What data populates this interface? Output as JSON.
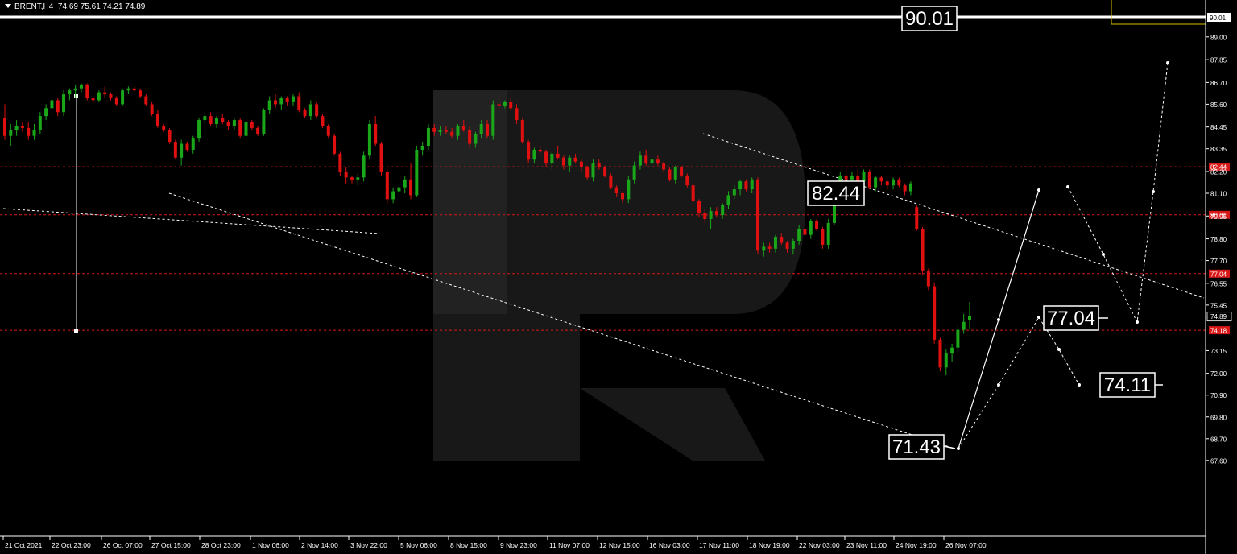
{
  "header": {
    "symbol": "BRENT,H4",
    "ohlc": "74.69 75.61 74.21 74.89"
  },
  "colors": {
    "background": "#000000",
    "bull": "#1aa81a",
    "bear": "#e01010",
    "level": "#d81818",
    "grid_text": "#ffffff",
    "watermark": "#2b2b2b",
    "sell_box": "#d4c000"
  },
  "chart_data": {
    "type": "candlestick",
    "y_axis_ticks": [
      "89.00",
      "87.85",
      "86.70",
      "85.60",
      "84.45",
      "83.35",
      "82.20",
      "81.10",
      "79.95",
      "78.80",
      "77.70",
      "76.55",
      "75.45",
      "74.89",
      "73.15",
      "72.00",
      "70.90",
      "69.80",
      "68.70",
      "67.60"
    ],
    "ylim": [
      67.6,
      90.2
    ],
    "x_axis_labels": [
      "21 Oct 2021",
      "22 Oct 23:00",
      "26 Oct 07:00",
      "27 Oct 15:00",
      "28 Oct 23:00",
      "1 Nov 06:00",
      "2 Nov 14:00",
      "3 Nov 22:00",
      "5 Nov 06:00",
      "8 Nov 15:00",
      "9 Nov 23:00",
      "11 Nov 07:00",
      "12 Nov 15:00",
      "16 Nov 03:00",
      "17 Nov 11:00",
      "18 Nov 19:00",
      "22 Nov 03:00",
      "23 Nov 11:00",
      "24 Nov 19:00",
      "26 Nov 07:00"
    ],
    "current_price": 74.89,
    "levels": [
      {
        "value": 90.01,
        "label": "90.01",
        "style": "solid-white"
      },
      {
        "value": 82.44,
        "label": "82.44",
        "style": "dashed-red"
      },
      {
        "value": 80.01,
        "label": "80.01",
        "style": "dashed-red"
      },
      {
        "value": 77.04,
        "label": "77.04",
        "style": "dashed-red"
      },
      {
        "value": 74.18,
        "label": "74.18",
        "style": "dashed-red"
      }
    ],
    "annotations": [
      {
        "text": "90.01",
        "value": 90.01
      },
      {
        "text": "82.44",
        "value": 82.44
      },
      {
        "text": "77.04",
        "value": 77.04
      },
      {
        "text": "74.11",
        "value": 74.11
      },
      {
        "text": "71.43",
        "value": 71.43
      }
    ],
    "candles": [
      [
        84.9,
        85.6,
        83.8,
        84.0
      ],
      [
        84.0,
        84.6,
        83.5,
        84.3
      ],
      [
        84.3,
        84.8,
        84.0,
        84.5
      ],
      [
        84.5,
        84.7,
        84.2,
        84.4
      ],
      [
        84.4,
        84.7,
        83.8,
        84.0
      ],
      [
        84.0,
        84.6,
        83.8,
        84.3
      ],
      [
        84.3,
        85.2,
        84.1,
        85.0
      ],
      [
        85.0,
        85.6,
        84.8,
        85.4
      ],
      [
        85.4,
        86.0,
        85.0,
        85.8
      ],
      [
        85.8,
        85.9,
        85.0,
        85.2
      ],
      [
        85.2,
        86.3,
        85.0,
        86.1
      ],
      [
        86.1,
        86.4,
        85.8,
        86.3
      ],
      [
        86.3,
        86.6,
        85.9,
        86.4
      ],
      [
        86.4,
        86.65,
        86.2,
        86.6
      ],
      [
        86.6,
        86.65,
        85.8,
        85.9
      ],
      [
        85.9,
        86.0,
        85.6,
        85.8
      ],
      [
        85.8,
        86.3,
        85.7,
        86.2
      ],
      [
        86.2,
        86.5,
        85.9,
        86.1
      ],
      [
        86.1,
        86.2,
        85.8,
        85.9
      ],
      [
        85.9,
        86.0,
        85.5,
        85.6
      ],
      [
        85.6,
        86.4,
        85.5,
        86.3
      ],
      [
        86.3,
        86.5,
        86.1,
        86.4
      ],
      [
        86.4,
        86.5,
        86.2,
        86.3
      ],
      [
        86.3,
        86.4,
        85.9,
        86.0
      ],
      [
        86.0,
        86.1,
        85.5,
        85.6
      ],
      [
        85.6,
        85.7,
        85.0,
        85.1
      ],
      [
        85.1,
        85.3,
        84.4,
        84.5
      ],
      [
        84.5,
        84.6,
        84.2,
        84.3
      ],
      [
        84.3,
        84.4,
        83.6,
        83.7
      ],
      [
        83.7,
        83.8,
        82.8,
        82.9
      ],
      [
        82.9,
        83.8,
        82.5,
        83.6
      ],
      [
        83.6,
        83.7,
        83.2,
        83.3
      ],
      [
        83.3,
        84.0,
        83.1,
        83.9
      ],
      [
        83.9,
        84.9,
        83.7,
        84.8
      ],
      [
        84.8,
        85.2,
        84.6,
        85.0
      ],
      [
        85.0,
        85.2,
        84.5,
        84.6
      ],
      [
        84.6,
        85.0,
        84.4,
        84.9
      ],
      [
        84.9,
        85.1,
        84.6,
        84.7
      ],
      [
        84.7,
        84.8,
        84.3,
        84.5
      ],
      [
        84.5,
        84.9,
        84.3,
        84.8
      ],
      [
        84.8,
        84.9,
        83.9,
        84.0
      ],
      [
        84.0,
        84.9,
        83.8,
        84.7
      ],
      [
        84.7,
        84.8,
        84.3,
        84.4
      ],
      [
        84.4,
        84.5,
        84.0,
        84.1
      ],
      [
        84.1,
        85.4,
        84.0,
        85.3
      ],
      [
        85.3,
        86.0,
        85.1,
        85.8
      ],
      [
        85.8,
        86.1,
        85.4,
        85.6
      ],
      [
        85.6,
        86.0,
        85.3,
        85.9
      ],
      [
        85.9,
        86.0,
        85.5,
        85.7
      ],
      [
        85.7,
        86.1,
        85.5,
        86.0
      ],
      [
        86.0,
        86.2,
        85.2,
        85.3
      ],
      [
        85.3,
        85.4,
        84.9,
        85.0
      ],
      [
        85.0,
        85.8,
        84.8,
        85.6
      ],
      [
        85.6,
        85.7,
        84.9,
        85.0
      ],
      [
        85.0,
        85.1,
        84.4,
        84.5
      ],
      [
        84.5,
        84.6,
        83.9,
        84.0
      ],
      [
        84.0,
        84.1,
        83.0,
        83.1
      ],
      [
        83.1,
        83.2,
        82.0,
        82.2
      ],
      [
        82.2,
        82.4,
        81.6,
        81.9
      ],
      [
        81.9,
        82.0,
        81.6,
        81.8
      ],
      [
        81.8,
        82.1,
        81.5,
        81.9
      ],
      [
        81.9,
        83.2,
        81.7,
        83.0
      ],
      [
        83.0,
        84.8,
        82.8,
        84.6
      ],
      [
        84.6,
        85.0,
        83.5,
        83.6
      ],
      [
        83.6,
        83.7,
        82.0,
        82.2
      ],
      [
        82.2,
        82.3,
        80.6,
        80.8
      ],
      [
        80.8,
        81.4,
        80.6,
        81.2
      ],
      [
        81.2,
        81.6,
        81.0,
        81.4
      ],
      [
        81.4,
        82.0,
        81.1,
        81.8
      ],
      [
        81.8,
        82.6,
        80.8,
        81.0
      ],
      [
        81.0,
        83.5,
        80.9,
        83.3
      ],
      [
        83.3,
        83.7,
        83.0,
        83.5
      ],
      [
        83.5,
        84.6,
        83.3,
        84.4
      ],
      [
        84.4,
        84.6,
        84.0,
        84.2
      ],
      [
        84.2,
        84.5,
        84.0,
        84.3
      ],
      [
        84.3,
        84.5,
        84.1,
        84.2
      ],
      [
        84.2,
        84.4,
        83.9,
        84.0
      ],
      [
        84.0,
        84.6,
        83.8,
        84.5
      ],
      [
        84.5,
        84.8,
        84.2,
        84.3
      ],
      [
        84.3,
        84.5,
        83.4,
        83.6
      ],
      [
        83.6,
        84.2,
        83.4,
        84.1
      ],
      [
        84.1,
        84.8,
        83.9,
        84.6
      ],
      [
        84.6,
        84.8,
        83.9,
        84.0
      ],
      [
        84.0,
        85.8,
        83.8,
        85.6
      ],
      [
        85.6,
        85.9,
        85.3,
        85.5
      ],
      [
        85.5,
        85.8,
        85.4,
        85.7
      ],
      [
        85.7,
        85.9,
        85.3,
        85.4
      ],
      [
        85.4,
        85.6,
        84.6,
        84.8
      ],
      [
        84.8,
        84.9,
        83.6,
        83.7
      ],
      [
        83.7,
        83.8,
        82.6,
        82.8
      ],
      [
        82.8,
        83.4,
        82.6,
        83.3
      ],
      [
        83.3,
        83.5,
        83.0,
        83.2
      ],
      [
        83.2,
        83.3,
        82.4,
        82.6
      ],
      [
        82.6,
        83.2,
        82.3,
        83.1
      ],
      [
        83.1,
        83.5,
        82.8,
        82.9
      ],
      [
        82.9,
        83.0,
        82.3,
        82.5
      ],
      [
        82.5,
        83.0,
        82.2,
        82.9
      ],
      [
        82.9,
        83.1,
        82.6,
        82.7
      ],
      [
        82.7,
        82.8,
        82.2,
        82.4
      ],
      [
        82.4,
        82.5,
        81.8,
        81.9
      ],
      [
        81.9,
        82.8,
        81.7,
        82.6
      ],
      [
        82.6,
        82.8,
        82.3,
        82.4
      ],
      [
        82.4,
        82.5,
        81.9,
        82.0
      ],
      [
        82.0,
        82.1,
        81.3,
        81.4
      ],
      [
        81.4,
        81.5,
        80.9,
        81.1
      ],
      [
        81.1,
        81.2,
        80.6,
        80.8
      ],
      [
        80.8,
        82.0,
        80.6,
        81.8
      ],
      [
        81.8,
        82.7,
        81.6,
        82.5
      ],
      [
        82.5,
        83.2,
        82.3,
        83.0
      ],
      [
        83.0,
        83.3,
        82.5,
        82.6
      ],
      [
        82.6,
        82.9,
        82.4,
        82.8
      ],
      [
        82.8,
        83.0,
        82.5,
        82.6
      ],
      [
        82.6,
        82.7,
        82.2,
        82.3
      ],
      [
        82.3,
        82.4,
        81.7,
        81.8
      ],
      [
        81.8,
        82.5,
        81.6,
        82.4
      ],
      [
        82.4,
        82.5,
        81.9,
        82.0
      ],
      [
        82.0,
        82.1,
        81.4,
        81.5
      ],
      [
        81.5,
        81.6,
        80.6,
        80.7
      ],
      [
        80.7,
        80.8,
        79.9,
        80.1
      ],
      [
        80.1,
        80.3,
        79.6,
        79.8
      ],
      [
        79.8,
        80.4,
        79.3,
        80.2
      ],
      [
        80.2,
        80.4,
        79.9,
        80.0
      ],
      [
        80.0,
        80.6,
        79.8,
        80.5
      ],
      [
        80.5,
        81.2,
        80.3,
        81.0
      ],
      [
        81.0,
        81.5,
        80.8,
        81.3
      ],
      [
        81.3,
        81.8,
        81.0,
        81.7
      ],
      [
        81.7,
        81.8,
        81.2,
        81.3
      ],
      [
        81.3,
        81.9,
        81.1,
        81.8
      ],
      [
        81.8,
        81.9,
        78.0,
        78.2
      ],
      [
        78.2,
        78.6,
        77.9,
        78.4
      ],
      [
        78.4,
        78.6,
        78.1,
        78.3
      ],
      [
        78.3,
        79.0,
        78.1,
        78.9
      ],
      [
        78.9,
        79.1,
        78.5,
        78.6
      ],
      [
        78.6,
        78.7,
        78.1,
        78.3
      ],
      [
        78.3,
        78.8,
        78.0,
        78.7
      ],
      [
        78.7,
        79.5,
        78.5,
        79.3
      ],
      [
        79.3,
        79.6,
        78.9,
        79.0
      ],
      [
        79.0,
        79.8,
        78.8,
        79.7
      ],
      [
        79.7,
        79.8,
        79.2,
        79.3
      ],
      [
        79.3,
        79.4,
        78.3,
        78.5
      ],
      [
        78.5,
        79.8,
        78.3,
        79.6
      ],
      [
        79.6,
        81.5,
        79.5,
        81.3
      ],
      [
        81.3,
        82.2,
        81.0,
        82.0
      ],
      [
        82.0,
        82.5,
        81.6,
        81.8
      ],
      [
        81.8,
        82.2,
        81.5,
        82.0
      ],
      [
        82.0,
        82.3,
        81.6,
        81.7
      ],
      [
        81.7,
        82.3,
        81.5,
        82.2
      ],
      [
        82.2,
        82.3,
        81.3,
        81.4
      ],
      [
        81.4,
        82.0,
        81.2,
        81.9
      ],
      [
        81.9,
        82.0,
        81.5,
        81.7
      ],
      [
        81.7,
        81.8,
        81.3,
        81.5
      ],
      [
        81.5,
        81.9,
        81.3,
        81.8
      ],
      [
        81.8,
        81.9,
        81.4,
        81.5
      ],
      [
        81.5,
        81.6,
        81.0,
        81.2
      ],
      [
        81.2,
        81.7,
        81.0,
        81.6
      ],
      [
        80.4,
        80.5,
        79.2,
        79.3
      ],
      [
        79.3,
        79.4,
        77.0,
        77.2
      ],
      [
        77.2,
        77.3,
        76.2,
        76.4
      ],
      [
        76.4,
        76.6,
        73.5,
        73.7
      ],
      [
        73.7,
        73.8,
        72.1,
        72.3
      ],
      [
        72.3,
        73.2,
        71.9,
        73.0
      ],
      [
        73.0,
        73.5,
        72.6,
        73.3
      ],
      [
        73.3,
        74.5,
        73.0,
        74.2
      ],
      [
        74.2,
        75.0,
        74.0,
        74.6
      ],
      [
        74.69,
        75.61,
        74.21,
        74.89
      ]
    ]
  }
}
